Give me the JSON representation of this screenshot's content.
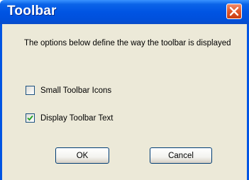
{
  "window": {
    "title": "Toolbar",
    "close_icon": "close-icon"
  },
  "dialog": {
    "description": "The options below define the way the toolbar is displayed",
    "options": [
      {
        "label": "Small Toolbar Icons",
        "checked": false
      },
      {
        "label": "Display Toolbar Text",
        "checked": true
      }
    ],
    "buttons": {
      "ok": "OK",
      "cancel": "Cancel"
    }
  },
  "colors": {
    "titlebar": "#0054e3",
    "close_button": "#e25a2e",
    "dialog_background": "#ece9d8"
  }
}
